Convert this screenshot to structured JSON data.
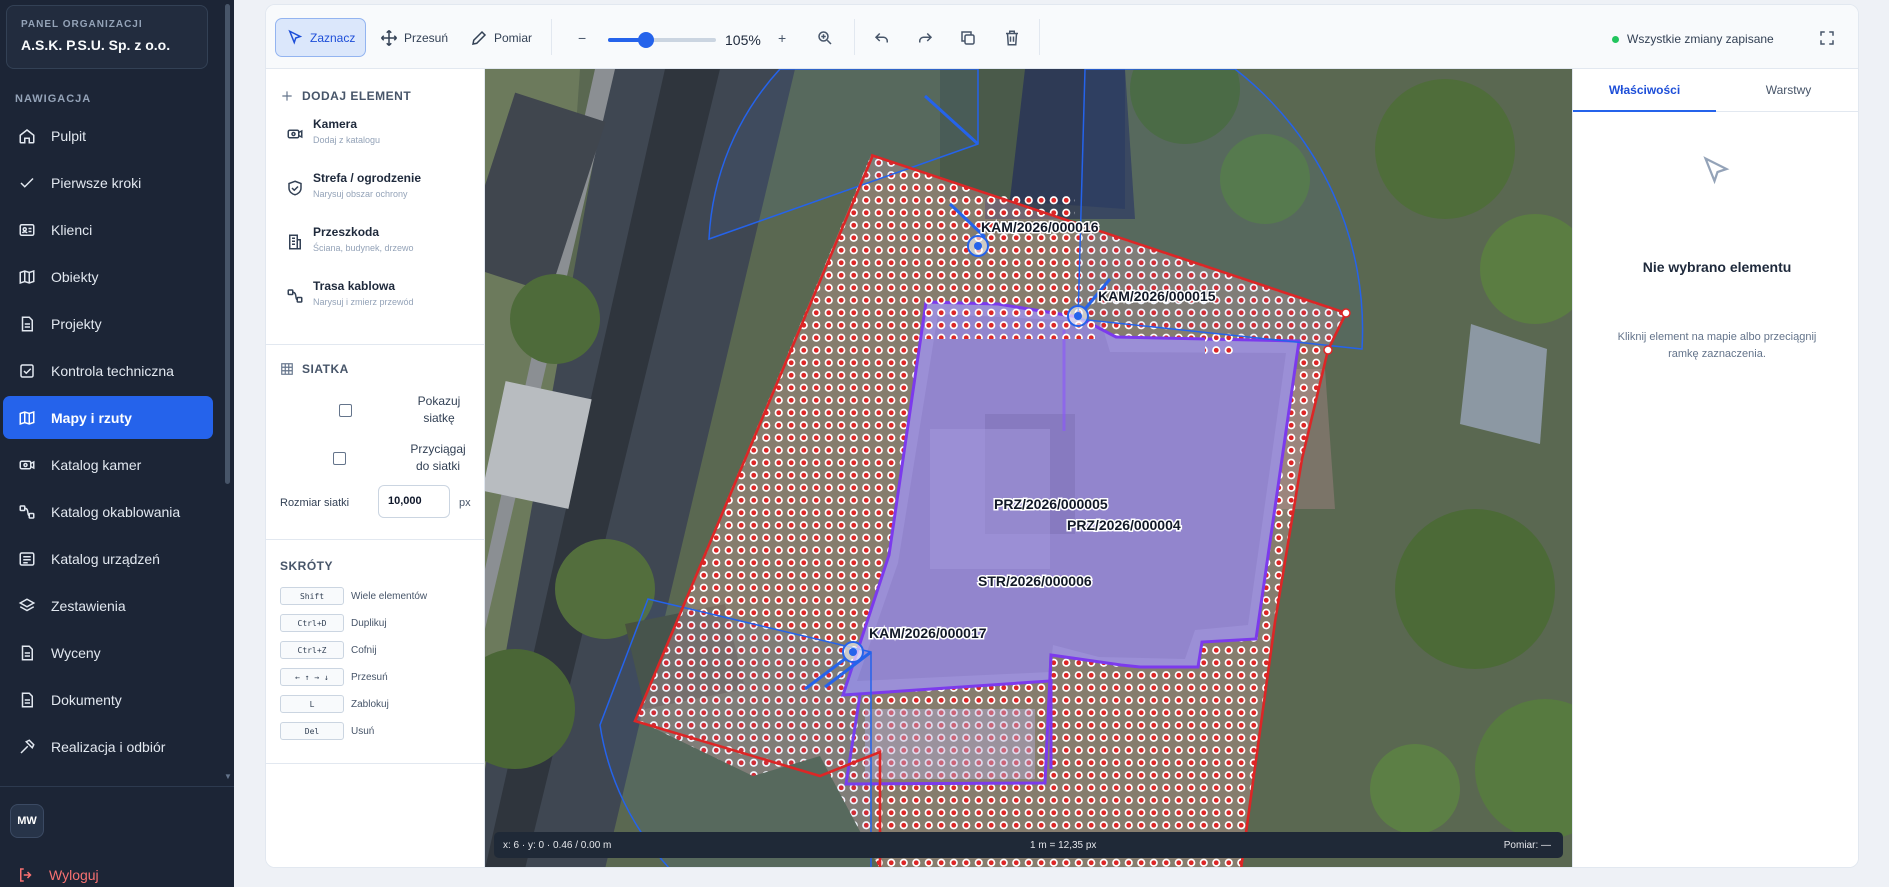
{
  "sidebar": {
    "org_caption": "PANEL ORGANIZACJI",
    "org_name": "A.S.K. P.S.U. Sp. z o.o.",
    "nav_caption": "NAWIGACJA",
    "items": [
      {
        "label": "Pulpit",
        "icon": "home-icon"
      },
      {
        "label": "Pierwsze kroki",
        "icon": "check-icon"
      },
      {
        "label": "Klienci",
        "icon": "contact-card-icon"
      },
      {
        "label": "Obiekty",
        "icon": "map-icon"
      },
      {
        "label": "Projekty",
        "icon": "document-icon"
      },
      {
        "label": "Kontrola techniczna",
        "icon": "checkbox-icon"
      },
      {
        "label": "Mapy i rzuty",
        "icon": "map-icon"
      },
      {
        "label": "Katalog kamer",
        "icon": "camera-icon"
      },
      {
        "label": "Katalog okablowania",
        "icon": "cable-icon"
      },
      {
        "label": "Katalog urządzeń",
        "icon": "device-list-icon"
      },
      {
        "label": "Zestawienia",
        "icon": "layers-icon"
      },
      {
        "label": "Wyceny",
        "icon": "document-icon"
      },
      {
        "label": "Dokumenty",
        "icon": "document-icon"
      },
      {
        "label": "Realizacja i odbiór",
        "icon": "hammer-icon"
      }
    ],
    "active_item": "Mapy i rzuty",
    "avatar_initials": "MW",
    "logout_label": "Wyloguj"
  },
  "toolbar": {
    "select_label": "Zaznacz",
    "move_label": "Przesuń",
    "measure_label": "Pomiar",
    "zoom_minus": "−",
    "zoom_plus": "+",
    "zoom_value": "105%",
    "zoom_slider_fraction": 0.35,
    "save_status": "Wszystkie zmiany zapisane"
  },
  "left_panel": {
    "add_heading": "DODAJ ELEMENT",
    "add_items": [
      {
        "title": "Kamera",
        "subtitle": "Dodaj z katalogu",
        "icon": "camera-icon"
      },
      {
        "title": "Strefa / ogrodzenie",
        "subtitle": "Narysuj obszar ochrony",
        "icon": "shield-icon"
      },
      {
        "title": "Przeszkoda",
        "subtitle": "Ściana, budynek, drzewo",
        "icon": "building-icon"
      },
      {
        "title": "Trasa kablowa",
        "subtitle": "Narysuj i zmierz przewód",
        "icon": "route-icon"
      }
    ],
    "grid_heading": "SIATKA",
    "show_grid_label": "Pokazuj siatkę",
    "show_grid_line1": "Pokazuj",
    "show_grid_line2": "siatkę",
    "snap_line1": "Przyciągaj",
    "snap_line2": "do siatki",
    "grid_size_label": "Rozmiar siatki",
    "grid_size_value": "10,000",
    "grid_size_unit": "px",
    "shortcuts_heading": "SKRÓTY",
    "shortcuts": [
      {
        "key": "Shift",
        "desc": "Wiele elementów"
      },
      {
        "key": "Ctrl+D",
        "desc": "Duplikuj"
      },
      {
        "key": "Ctrl+Z",
        "desc": "Cofnij"
      },
      {
        "key": "← ↑ → ↓",
        "desc": "Przesuń"
      },
      {
        "key": "L",
        "desc": "Zablokuj"
      },
      {
        "key": "Del",
        "desc": "Usuń"
      }
    ]
  },
  "map": {
    "labels": {
      "cam16": "KAM/2026/000016",
      "cam15": "KAM/2026/000015",
      "cam17": "KAM/2026/000017",
      "prz5": "PRZ/2026/000005",
      "prz4": "PRZ/2026/000004",
      "str6": "STR/2026/000006"
    },
    "status_coords": "x: 6 · y: 0 · 0.46 / 0.00 m",
    "status_scale": "1 m = 12,35 px",
    "status_measure": "Pomiar: —"
  },
  "right_panel": {
    "tab_properties": "Właściwości",
    "tab_layers": "Warstwy",
    "empty_title": "Nie wybrano elementu",
    "empty_subtitle": "Kliknij element na mapie albo przeciągnij ramkę zaznaczenia."
  },
  "colors": {
    "accent": "#2563eb",
    "sidebar_bg": "#1c2536",
    "zone_red": "#dc2626",
    "obstacle_purple": "#7c3aed",
    "camera_blue": "#2563eb",
    "saved_green": "#22c55e"
  }
}
